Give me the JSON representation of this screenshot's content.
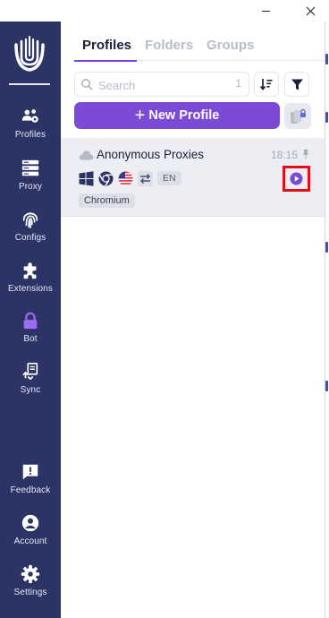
{
  "window": {
    "minimize_glyph": "—",
    "close_glyph": "✕"
  },
  "sidebar": {
    "logo": "fingerprint-u-logo",
    "items": [
      {
        "label": "Profiles",
        "icon": "profiles-icon"
      },
      {
        "label": "Proxy",
        "icon": "proxy-server-icon"
      },
      {
        "label": "Configs",
        "icon": "fingerprint-icon"
      },
      {
        "label": "Extensions",
        "icon": "puzzle-icon"
      },
      {
        "label": "Bot",
        "icon": "lock-icon"
      },
      {
        "label": "Sync",
        "icon": "sync-icon"
      }
    ],
    "bottom_items": [
      {
        "label": "Feedback",
        "icon": "feedback-icon"
      },
      {
        "label": "Account",
        "icon": "account-icon"
      },
      {
        "label": "Settings",
        "icon": "gear-icon"
      }
    ]
  },
  "main": {
    "tabs": [
      {
        "label": "Profiles",
        "active": true
      },
      {
        "label": "Folders",
        "active": false
      },
      {
        "label": "Groups",
        "active": false
      }
    ],
    "search": {
      "placeholder": "Search",
      "value": "",
      "count": "1"
    },
    "new_profile_label": "New Profile",
    "profiles": [
      {
        "name": "Anonymous Proxies",
        "time": "18:15",
        "os": "windows",
        "browser": "chrome",
        "country": "us",
        "language": "EN",
        "browser_tag": "Chromium"
      }
    ]
  },
  "colors": {
    "sidebar_bg": "#2c3466",
    "accent": "#7c4bd6",
    "row_bg": "#eceef3",
    "highlight": "#e3101a"
  }
}
